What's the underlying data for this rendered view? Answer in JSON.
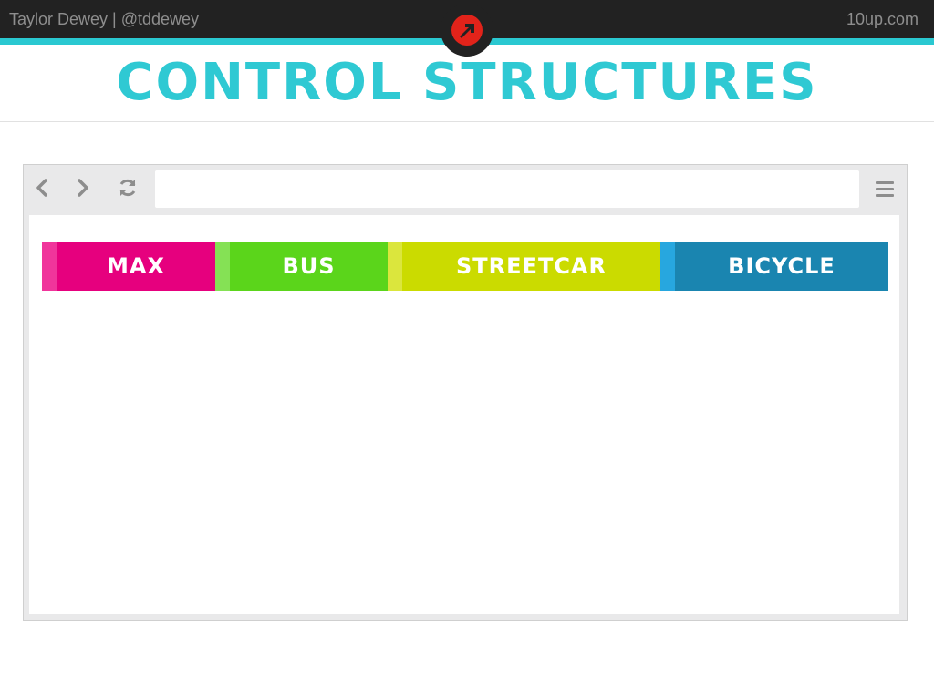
{
  "header": {
    "author": "Taylor Dewey | @tddewey",
    "site": "10up.com",
    "logo_icon": "10up-arrow-logo-icon",
    "accent_color": "#2ac8d1"
  },
  "slide": {
    "title": "CONTROL STRUCTURES",
    "title_color": "#2fc9d3"
  },
  "browser": {
    "url_value": "",
    "back_icon": "chevron-left-icon",
    "forward_icon": "chevron-right-icon",
    "reload_icon": "refresh-icon",
    "menu_icon": "hamburger-menu-icon"
  },
  "tabs": [
    {
      "label": "MAX",
      "color": "#e6007e",
      "stripe": "#f0359b"
    },
    {
      "label": "BUS",
      "color": "#5bd51b",
      "stripe": "#85e155"
    },
    {
      "label": "STREETCAR",
      "color": "#cbdb00",
      "stripe": "#dbe63d"
    },
    {
      "label": "BICYCLE",
      "color": "#1a85b0",
      "stripe": "#27a7df"
    }
  ]
}
